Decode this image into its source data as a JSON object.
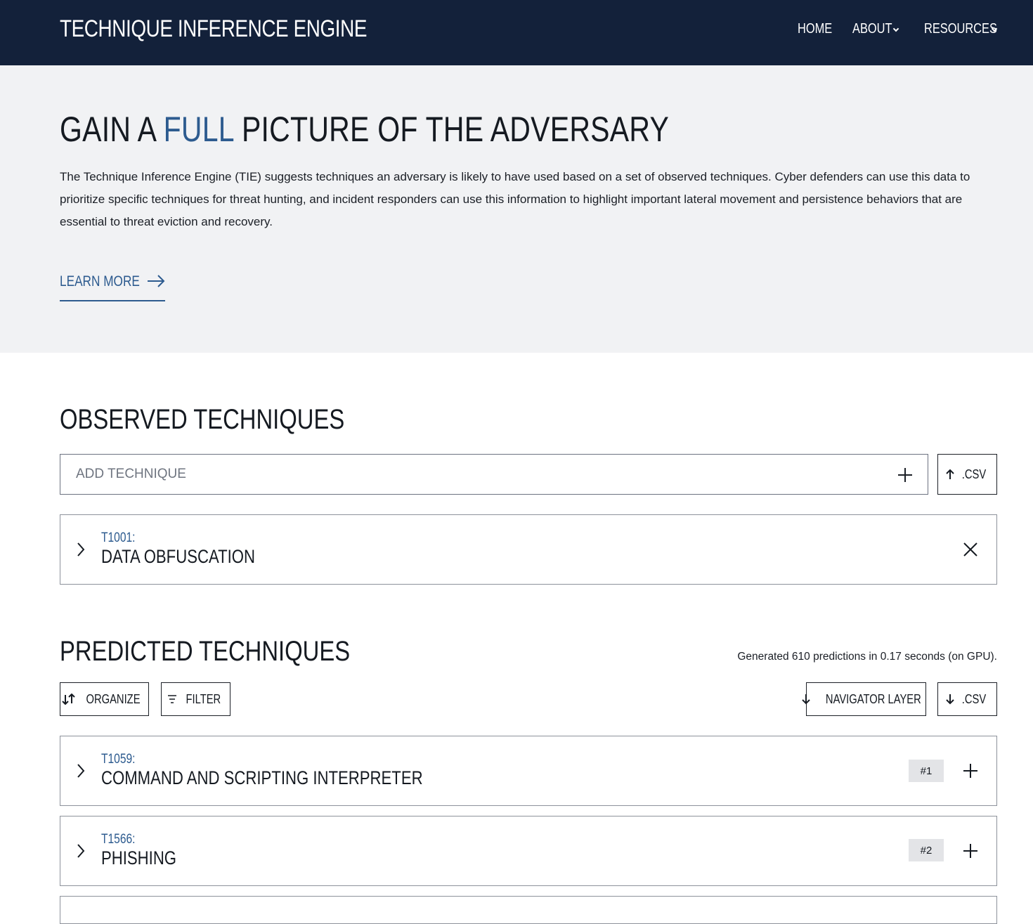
{
  "nav": {
    "brand": "TECHNIQUE INFERENCE ENGINE",
    "links": [
      {
        "label": "HOME",
        "has_dropdown": false
      },
      {
        "label": "ABOUT",
        "has_dropdown": true
      },
      {
        "label": "RESOURCES",
        "has_dropdown": true
      }
    ]
  },
  "hero": {
    "title_before": "GAIN A ",
    "title_accent": "FULL",
    "title_after": " PICTURE OF THE ADVERSARY",
    "description": "The Technique Inference Engine (TIE) suggests techniques an adversary is likely to have used based on a set of observed techniques. Cyber defenders can use this data to prioritize specific techniques for threat hunting, and incident responders can use this information to highlight important lateral movement and persistence behaviors that are essential to threat eviction and recovery.",
    "learn_more": "LEARN MORE"
  },
  "observed": {
    "title": "OBSERVED TECHNIQUES",
    "add_placeholder": "ADD TECHNIQUE",
    "csv_label": ".CSV",
    "items": [
      {
        "id": "T1001:",
        "name": "DATA OBFUSCATION"
      }
    ]
  },
  "predicted": {
    "title": "PREDICTED TECHNIQUES",
    "generated_text": "Generated 610 predictions in 0.17 seconds (on GPU).",
    "organize_label": "ORGANIZE",
    "filter_label": "FILTER",
    "navigator_label": "NAVIGATOR LAYER",
    "csv_label": ".CSV",
    "items": [
      {
        "id": "T1059:",
        "name": "COMMAND AND SCRIPTING INTERPRETER",
        "rank": "#1"
      },
      {
        "id": "T1566:",
        "name": "PHISHING",
        "rank": "#2"
      }
    ]
  },
  "colors": {
    "nav_bg": "#13213a",
    "accent": "#2d5b8f",
    "hero_bg": "#f1f2f4"
  },
  "icons": [
    "chevron-down-icon",
    "arrow-right-icon",
    "plus-icon",
    "arrow-up-icon",
    "chevron-right-icon",
    "close-icon",
    "sort-icon",
    "filter-icon",
    "arrow-down-icon"
  ]
}
